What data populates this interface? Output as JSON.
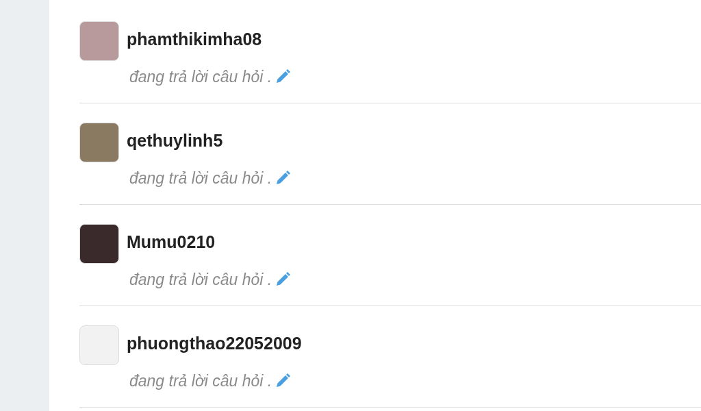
{
  "users": [
    {
      "username": "phamthikimha08",
      "status": "đang trả lời câu hỏi ."
    },
    {
      "username": "qethuylinh5",
      "status": "đang trả lời câu hỏi ."
    },
    {
      "username": "Mumu0210",
      "status": "đang trả lời câu hỏi ."
    },
    {
      "username": "phuongthao22052009",
      "status": "đang trả lời câu hỏi ."
    }
  ]
}
